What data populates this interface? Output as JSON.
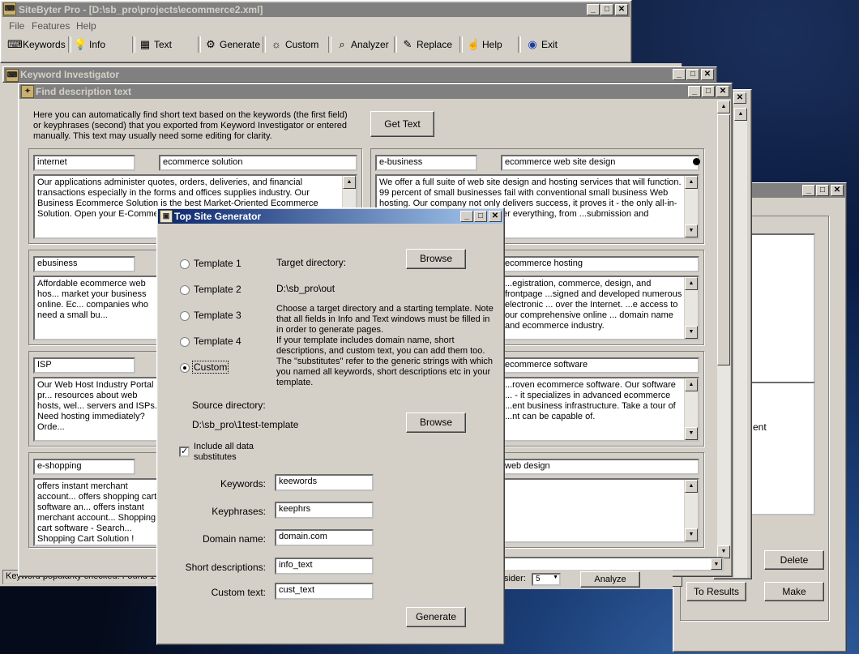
{
  "main_window": {
    "title": "SiteByter Pro  -  [D:\\sb_pro\\projects\\ecommerce2.xml]",
    "menu": [
      "File",
      "Features",
      "Help"
    ],
    "toolbar": [
      {
        "label": "Keywords",
        "icon": "keywords-icon",
        "glyph": "⌨"
      },
      {
        "label": "Info",
        "icon": "info-icon",
        "glyph": "💡"
      },
      {
        "label": "Text",
        "icon": "text-icon",
        "glyph": "▦"
      },
      {
        "label": "Generate",
        "icon": "generate-icon",
        "glyph": "⚙"
      },
      {
        "label": "Custom",
        "icon": "custom-icon",
        "glyph": "☼"
      },
      {
        "label": "Analyzer",
        "icon": "analyzer-icon",
        "glyph": "⌕"
      },
      {
        "label": "Replace",
        "icon": "replace-icon",
        "glyph": "✎"
      },
      {
        "label": "Help",
        "icon": "help-icon",
        "glyph": "☝"
      },
      {
        "label": "Exit",
        "icon": "exit-icon",
        "glyph": "◉"
      }
    ],
    "status": "Keyword popularity checked. Found 1..."
  },
  "keyword_investigator": {
    "title": "Keyword Investigator"
  },
  "find_description": {
    "title": "Find description text",
    "intro": "Here you can automatically find short text based on the keywords (the first field) or keyphrases (second) that you exported from Keyword Investigator or entered manually. This text may usually need some editing for clarity.",
    "get_text_label": "Get Text",
    "left_groups": [
      {
        "keyword": "internet",
        "phrase": "ecommerce solution",
        "text": "Our applications administer quotes, orders, deliveries, and financial transactions especially in the forms and offices supplies industry. Our Business Ecommerce Solution is the best Market-Oriented Ecommerce Solution. Open your E-Commerce Shop, get your ow... products online!"
      },
      {
        "keyword": "ebusiness",
        "phrase": "",
        "text": "Affordable ecommerce web hos... market your business online. Ec... companies who need a small bu..."
      },
      {
        "keyword": "ISP",
        "phrase": "",
        "text": "Our Web Host Industry Portal pr... resources about web hosts, wel... servers and ISPs. Need hosting immediately? Orde..."
      },
      {
        "keyword": "e-shopping",
        "phrase": "",
        "text": "offers instant merchant account... offers shopping cart software an... offers instant merchant account... Shopping cart software - Search... Shopping Cart Solution !  Setup... Ecommerce Shopping Carts. Se..."
      }
    ],
    "right_groups": [
      {
        "keyword": "e-business",
        "phrase": "ecommerce web site design",
        "text": "We offer a full suite of web site design and hosting services that will function. 99 percent of small businesses fail with conventional small business Web hosting. Our company not only delivers success, it proves it - the only all-in-one ...g and marketing. We cover everything, from ...submission and optimization."
      },
      {
        "keyword": "",
        "phrase": "ecommerce hosting",
        "text": "...egistration, commerce, design, and frontpage ...signed and developed numerous electronic ... over the Internet. ...e access to our comprehensive online ... domain name and ecommerce industry."
      },
      {
        "keyword": "",
        "phrase": "ecommerce software",
        "text": "...roven ecommerce software. Our software ... - it specializes in advanced ecommerce ...ent business infrastructure. Take a tour of ...nt can be capable of."
      },
      {
        "keyword": "",
        "phrase": "web design",
        "text": ""
      }
    ]
  },
  "back_window": {
    "delete_label": "Delete",
    "to_results_label": "To Results",
    "make_label": "Make",
    "fragment_text": "ent",
    "analyze_label": "Analyze",
    "consider_label": "sider:",
    "consider_value": "5"
  },
  "top_site_generator": {
    "title": "Top Site Generator",
    "templates": [
      {
        "label": "Template 1",
        "selected": false
      },
      {
        "label": "Template 2",
        "selected": false
      },
      {
        "label": "Template 3",
        "selected": false
      },
      {
        "label": "Template 4",
        "selected": false
      },
      {
        "label": "Custom",
        "selected": true
      }
    ],
    "target_dir_label": "Target directory:",
    "target_dir_value": "D:\\sb_pro\\out",
    "browse_label": "Browse",
    "help_text": "Choose a target directory and a starting template. Note that all fields in Info and Text windows must be filled in in order to generate pages.\nIf your template includes domain name, short descriptions, and custom text, you can add them too.\nThe \"substitutes\" refer to the generic strings with which you named all keywords, short descriptions etc in your template.",
    "source_dir_label": "Source directory:",
    "source_dir_value": "D:\\sb_pro\\1test-template",
    "include_label": "Include all data substitutes",
    "include_checked": true,
    "fields": [
      {
        "label": "Keywords:",
        "value": "keewords"
      },
      {
        "label": "Keyphrases:",
        "value": "keephrs"
      },
      {
        "label": "Domain name:",
        "value": "domain.com"
      },
      {
        "label": "Short descriptions:",
        "value": "info_text"
      },
      {
        "label": "Custom text:",
        "value": "cust_text"
      }
    ],
    "generate_label": "Generate"
  }
}
